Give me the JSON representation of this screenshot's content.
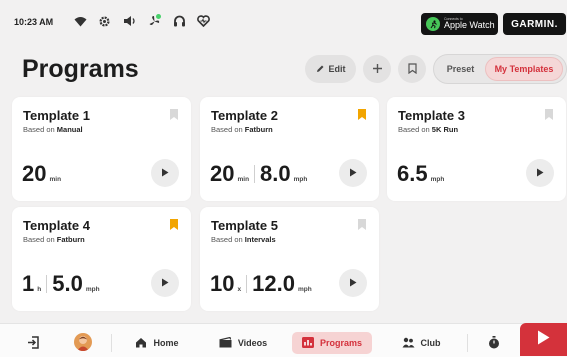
{
  "status": {
    "time": "10:23 AM"
  },
  "apple_watch": {
    "small": "Connects to",
    "big": "Apple Watch"
  },
  "garmin": "GARMIN.",
  "header": {
    "title": "Programs",
    "edit_label": "Edit",
    "tabs": {
      "preset": "Preset",
      "my_templates": "My Templates"
    }
  },
  "colors": {
    "accent": "#d4313c",
    "active_bg": "#f6d3d3",
    "bookmark_active": "#f2a500",
    "bookmark_inactive": "#d8d8d8"
  },
  "templates": [
    {
      "title": "Template 1",
      "based_prefix": "Based on",
      "based_on": "Manual",
      "bookmarked": false,
      "stat1_value": "20",
      "stat1_unit": "min",
      "stat2_value": "",
      "stat2_unit": ""
    },
    {
      "title": "Template 2",
      "based_prefix": "Based on",
      "based_on": "Fatburn",
      "bookmarked": true,
      "stat1_value": "20",
      "stat1_unit": "min",
      "stat2_value": "8.0",
      "stat2_unit": "mph"
    },
    {
      "title": "Template 3",
      "based_prefix": "Based on",
      "based_on": "5K Run",
      "bookmarked": false,
      "stat1_value": "6.5",
      "stat1_unit": "mph",
      "stat2_value": "",
      "stat2_unit": ""
    },
    {
      "title": "Template 4",
      "based_prefix": "Based on",
      "based_on": "Fatburn",
      "bookmarked": true,
      "stat1_value": "1",
      "stat1_unit": "h",
      "stat2_value": "5.0",
      "stat2_unit": "mph"
    },
    {
      "title": "Template 5",
      "based_prefix": "Based on",
      "based_on": "Intervals",
      "bookmarked": false,
      "stat1_value": "10",
      "stat1_unit": "x",
      "stat2_value": "12.0",
      "stat2_unit": "mph"
    }
  ],
  "nav": {
    "home": "Home",
    "videos": "Videos",
    "programs": "Programs",
    "club": "Club"
  }
}
